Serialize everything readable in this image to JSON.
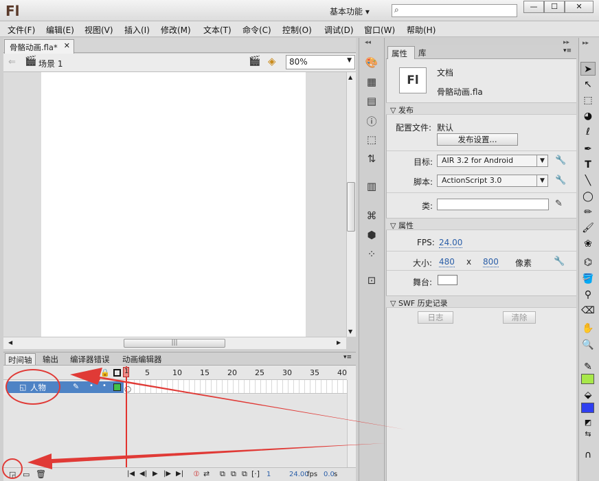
{
  "window": {
    "logo": "Fl",
    "workspace": "基本功能",
    "search_placeholder": "",
    "controls": [
      "—",
      "☐",
      "✕"
    ]
  },
  "menu": [
    "文件(F)",
    "编辑(E)",
    "视图(V)",
    "插入(I)",
    "修改(M)",
    "文本(T)",
    "命令(C)",
    "控制(O)",
    "调试(D)",
    "窗口(W)",
    "帮助(H)"
  ],
  "document": {
    "tab_title": "骨骼动画.fla*",
    "scene": "场景 1",
    "zoom": "80%"
  },
  "timeline": {
    "tabs": [
      "时间轴",
      "输出",
      "编译器错误",
      "动画编辑器"
    ],
    "layer_name": "人物",
    "ruler": [
      "1",
      "5",
      "10",
      "15",
      "20",
      "25",
      "30",
      "35",
      "40"
    ],
    "fps": "24.00",
    "fps_unit": "fps",
    "time": "0.0",
    "time_unit": "s",
    "current_frame": "1"
  },
  "properties": {
    "tabs": [
      "属性",
      "库"
    ],
    "doc_type": "文档",
    "doc_icon_label": "Fl",
    "file_name": "骨骼动画.fla",
    "publish_section": "发布",
    "profile_label": "配置文件:",
    "profile_value": "默认",
    "publish_settings_btn": "发布设置...",
    "target_label": "目标:",
    "target_value": "AIR 3.2 for Android",
    "script_label": "脚本:",
    "script_value": "ActionScript 3.0",
    "class_label": "类:",
    "props_section": "属性",
    "fps_label": "FPS:",
    "fps_value": "24.00",
    "size_label": "大小:",
    "width": "480",
    "x": "x",
    "height": "800",
    "unit": "像素",
    "stage_label": "舞台:",
    "stage_color": "#ffffff",
    "swf_section": "SWF 历史记录",
    "log_btn": "日志",
    "clear_btn": "清除"
  },
  "colors": {
    "stroke_swatch": "#a8e84a",
    "fill_swatch": "#2f3ff0",
    "layer_highlight": "#4e83c5",
    "playhead": "#e2332e",
    "annotation": "#e03a36"
  }
}
